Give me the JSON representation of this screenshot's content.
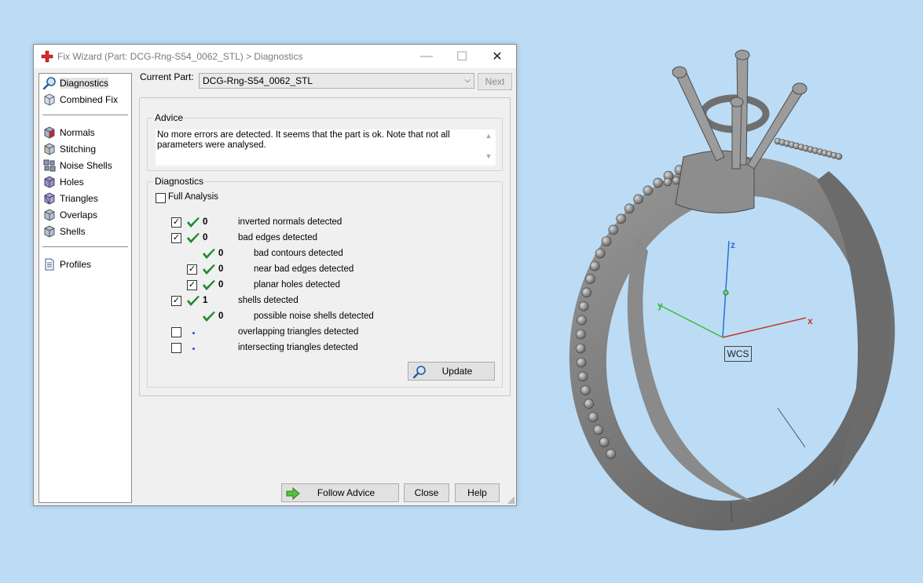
{
  "window": {
    "title": "Fix Wizard (Part: DCG-Rng-S54_0062_STL) > Diagnostics",
    "minimize": "—",
    "maximize": "☐",
    "close": "✕"
  },
  "nav": {
    "items": [
      {
        "label": "Diagnostics",
        "icon": "magnifier-icon",
        "selected": true
      },
      {
        "label": "Combined Fix",
        "icon": "cube-icon"
      },
      {
        "label": "Normals",
        "icon": "normals-cube-icon"
      },
      {
        "label": "Stitching",
        "icon": "stitching-cube-icon"
      },
      {
        "label": "Noise Shells",
        "icon": "noise-shells-icon"
      },
      {
        "label": "Holes",
        "icon": "holes-cube-icon"
      },
      {
        "label": "Triangles",
        "icon": "triangles-cube-icon"
      },
      {
        "label": "Overlaps",
        "icon": "overlaps-cube-icon"
      },
      {
        "label": "Shells",
        "icon": "shells-cube-icon"
      },
      {
        "label": "Profiles",
        "icon": "document-icon"
      }
    ]
  },
  "current_part": {
    "label": "Current Part:",
    "value": "DCG-Rng-S54_0062_STL",
    "next_label": "Next"
  },
  "advice": {
    "title": "Advice",
    "text": "No more errors are detected. It seems that the part is ok. Note that not all parameters were analysed."
  },
  "diagnostics": {
    "title": "Diagnostics",
    "full_analysis_label": "Full Analysis",
    "rows": [
      {
        "checkbox": true,
        "checked": true,
        "status": "check",
        "count": "0",
        "label": "inverted normals detected",
        "indent": 0
      },
      {
        "checkbox": true,
        "checked": true,
        "status": "check",
        "count": "0",
        "label": "bad edges detected",
        "indent": 0
      },
      {
        "checkbox": false,
        "checked": false,
        "status": "check",
        "count": "0",
        "label": "bad contours detected",
        "indent": 1
      },
      {
        "checkbox": true,
        "checked": true,
        "status": "check",
        "count": "0",
        "label": "near bad edges detected",
        "indent": 1
      },
      {
        "checkbox": true,
        "checked": true,
        "status": "check",
        "count": "0",
        "label": "planar holes detected",
        "indent": 1
      },
      {
        "checkbox": true,
        "checked": true,
        "status": "check",
        "count": "1",
        "label": "shells detected",
        "indent": 0
      },
      {
        "checkbox": false,
        "checked": false,
        "status": "check",
        "count": "0",
        "label": "possible noise shells detected",
        "indent": 1
      },
      {
        "checkbox": true,
        "checked": false,
        "status": "dot",
        "count": "",
        "label": "overlapping triangles detected",
        "indent": 0
      },
      {
        "checkbox": true,
        "checked": false,
        "status": "dot",
        "count": "",
        "label": "intersecting triangles detected",
        "indent": 0
      }
    ],
    "update_label": "Update"
  },
  "footer": {
    "follow_advice_label": "Follow Advice",
    "close_label": "Close",
    "help_label": "Help"
  },
  "viewport": {
    "axes": {
      "z": "z",
      "y": "y",
      "x": "x"
    },
    "wcs_label": "WCS"
  },
  "colors": {
    "desktop": "#bcdcf5",
    "check_green": "#1f8a2b",
    "axis_x": "#c0392b",
    "axis_y": "#3bbf3b",
    "axis_z": "#2d6fd6"
  }
}
